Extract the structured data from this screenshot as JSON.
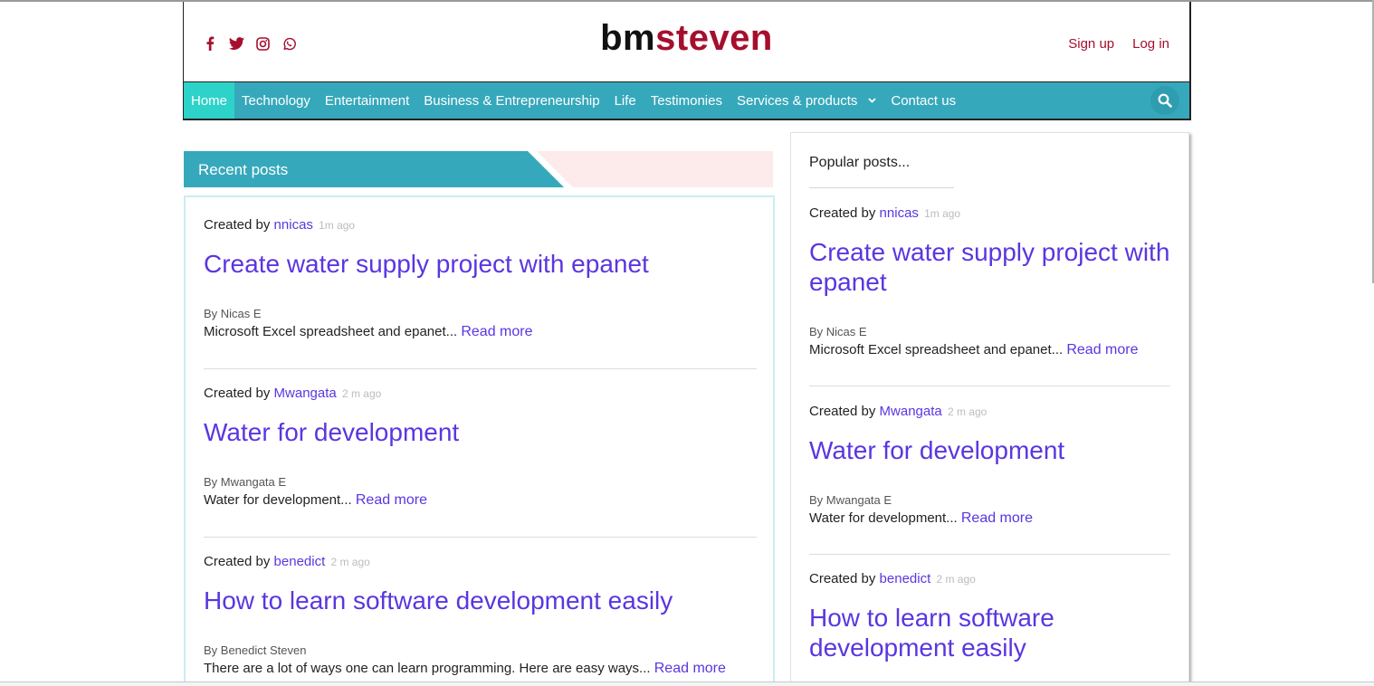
{
  "brand": {
    "part1": "bm",
    "part2": "steven"
  },
  "socials": [
    {
      "icon": "facebook-icon"
    },
    {
      "icon": "twitter-icon"
    },
    {
      "icon": "instagram-icon"
    },
    {
      "icon": "whatsapp-icon"
    }
  ],
  "auth": {
    "signup": "Sign up",
    "login": "Log in"
  },
  "nav": {
    "items": [
      "Home",
      "Technology",
      "Entertainment",
      "Business & Entrepreneurship",
      "Life",
      "Testimonies",
      "Services & products",
      "Contact us"
    ],
    "active": "Home",
    "search_icon": "search-icon"
  },
  "recent": {
    "title": "Recent posts",
    "posts": [
      {
        "created_label": "Created by",
        "author": "nnicas",
        "ago": "1m ago",
        "title": "Create water supply project with epanet",
        "byline": "By Nicas E",
        "excerpt": "Microsoft Excel spreadsheet and epanet...",
        "read_more": "Read more"
      },
      {
        "created_label": "Created by",
        "author": "Mwangata",
        "ago": "2 m ago",
        "title": "Water for development",
        "byline": "By Mwangata E",
        "excerpt": "Water for development...",
        "read_more": "Read more"
      },
      {
        "created_label": "Created by",
        "author": "benedict",
        "ago": "2 m ago",
        "title": "How to learn software development easily",
        "byline": "By Benedict Steven",
        "excerpt": "There are a lot of ways one can learn programming. Here are easy ways...",
        "read_more": "Read more"
      }
    ]
  },
  "popular": {
    "title": "Popular posts...",
    "posts": [
      {
        "created_label": "Created by",
        "author": "nnicas",
        "ago": "1m ago",
        "title": "Create water supply project with epanet",
        "byline": "By Nicas E",
        "excerpt": "Microsoft Excel spreadsheet and epanet...",
        "read_more": "Read more"
      },
      {
        "created_label": "Created by",
        "author": "Mwangata",
        "ago": "2 m ago",
        "title": "Water for development",
        "byline": "By Mwangata E",
        "excerpt": "Water for development...",
        "read_more": "Read more"
      },
      {
        "created_label": "Created by",
        "author": "benedict",
        "ago": "2 m ago",
        "title": "How to learn software development easily"
      }
    ]
  },
  "colors": {
    "brand_red": "#a50f2d",
    "nav_teal": "#36a8bb",
    "nav_active": "#2dd3c9",
    "link_purple": "#5a36e0",
    "recent_pink": "#fdeaea"
  }
}
